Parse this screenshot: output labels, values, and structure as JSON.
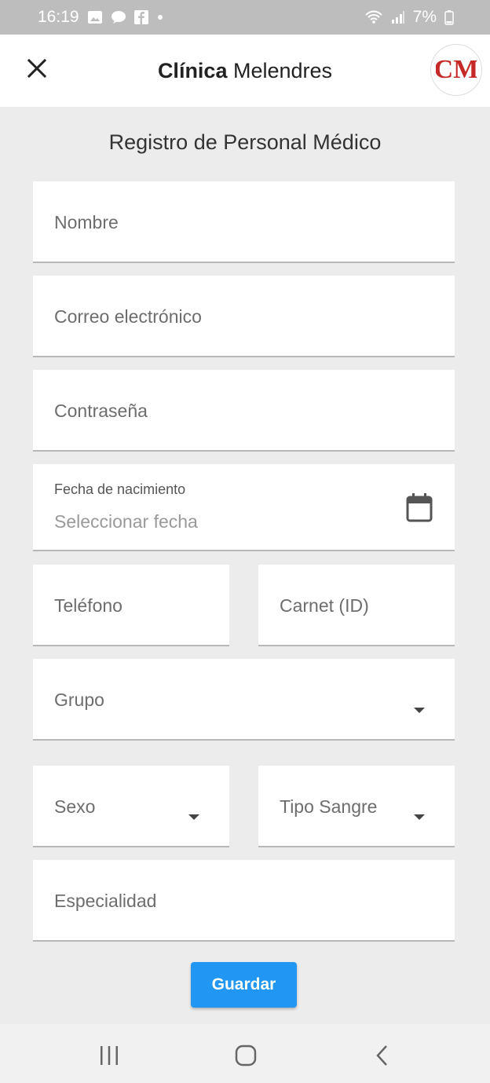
{
  "status_bar": {
    "time": "16:19",
    "icons_left": [
      "image-icon",
      "chat-icon",
      "facebook-icon",
      "dot-icon"
    ],
    "icons_right": [
      "wifi-icon",
      "signal-icon"
    ],
    "battery": "7%"
  },
  "app_bar": {
    "title_bold": "Clínica",
    "title_rest": "Melendres",
    "logo_text": "CM"
  },
  "form": {
    "title": "Registro de Personal Médico",
    "fields": {
      "nombre": "Nombre",
      "correo": "Correo electrónico",
      "contrasena": "Contraseña",
      "fecha_label": "Fecha de nacimiento",
      "fecha_placeholder": "Seleccionar fecha",
      "telefono": "Teléfono",
      "carnet": "Carnet (ID)",
      "grupo": "Grupo",
      "sexo": "Sexo",
      "tipo_sangre": "Tipo Sangre",
      "especialidad": "Especialidad"
    },
    "save_label": "Guardar"
  },
  "colors": {
    "primary": "#2196f3",
    "status_bar": "#bdbdbd",
    "background": "#ececec",
    "logo_red": "#c62828"
  }
}
